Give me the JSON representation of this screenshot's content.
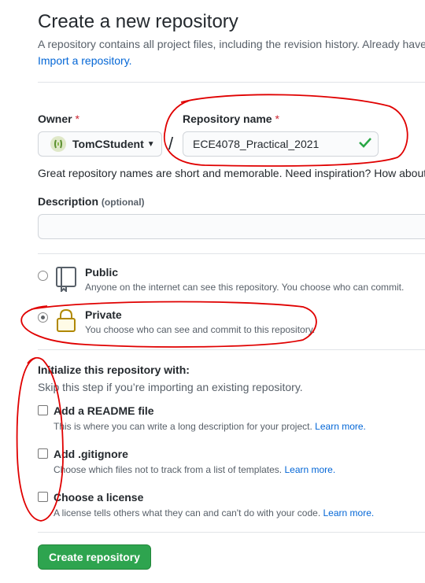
{
  "page": {
    "title": "Create a new repository",
    "intro": "A repository contains all project files, including the revision history. Already have",
    "import_link": "Import a repository."
  },
  "owner": {
    "label": "Owner",
    "required_mark": "*",
    "selected": "TomCStudent"
  },
  "repo_name": {
    "label": "Repository name",
    "required_mark": "*",
    "value": "ECE4078_Practical_2021"
  },
  "slash": "/",
  "hint": "Great repository names are short and memorable. Need inspiration? How about",
  "description": {
    "label": "Description",
    "optional": "(optional)",
    "value": ""
  },
  "visibility": {
    "public": {
      "title": "Public",
      "note": "Anyone on the internet can see this repository. You choose who can commit."
    },
    "private": {
      "title": "Private",
      "note": "You choose who can see and commit to this repository."
    },
    "selected": "private"
  },
  "initialize": {
    "heading": "Initialize this repository with:",
    "subheading": "Skip this step if you’re importing an existing repository.",
    "options": [
      {
        "title": "Add a README file",
        "note": "This is where you can write a long description for your project.",
        "link": "Learn more."
      },
      {
        "title": "Add .gitignore",
        "note": "Choose which files not to track from a list of templates.",
        "link": "Learn more."
      },
      {
        "title": "Choose a license",
        "note": "A license tells others what they can and can't do with your code.",
        "link": "Learn more."
      }
    ]
  },
  "create_button": "Create repository",
  "colors": {
    "primary_button": "#2ea44f",
    "link": "#0366d6",
    "annotation": "#e00000"
  }
}
